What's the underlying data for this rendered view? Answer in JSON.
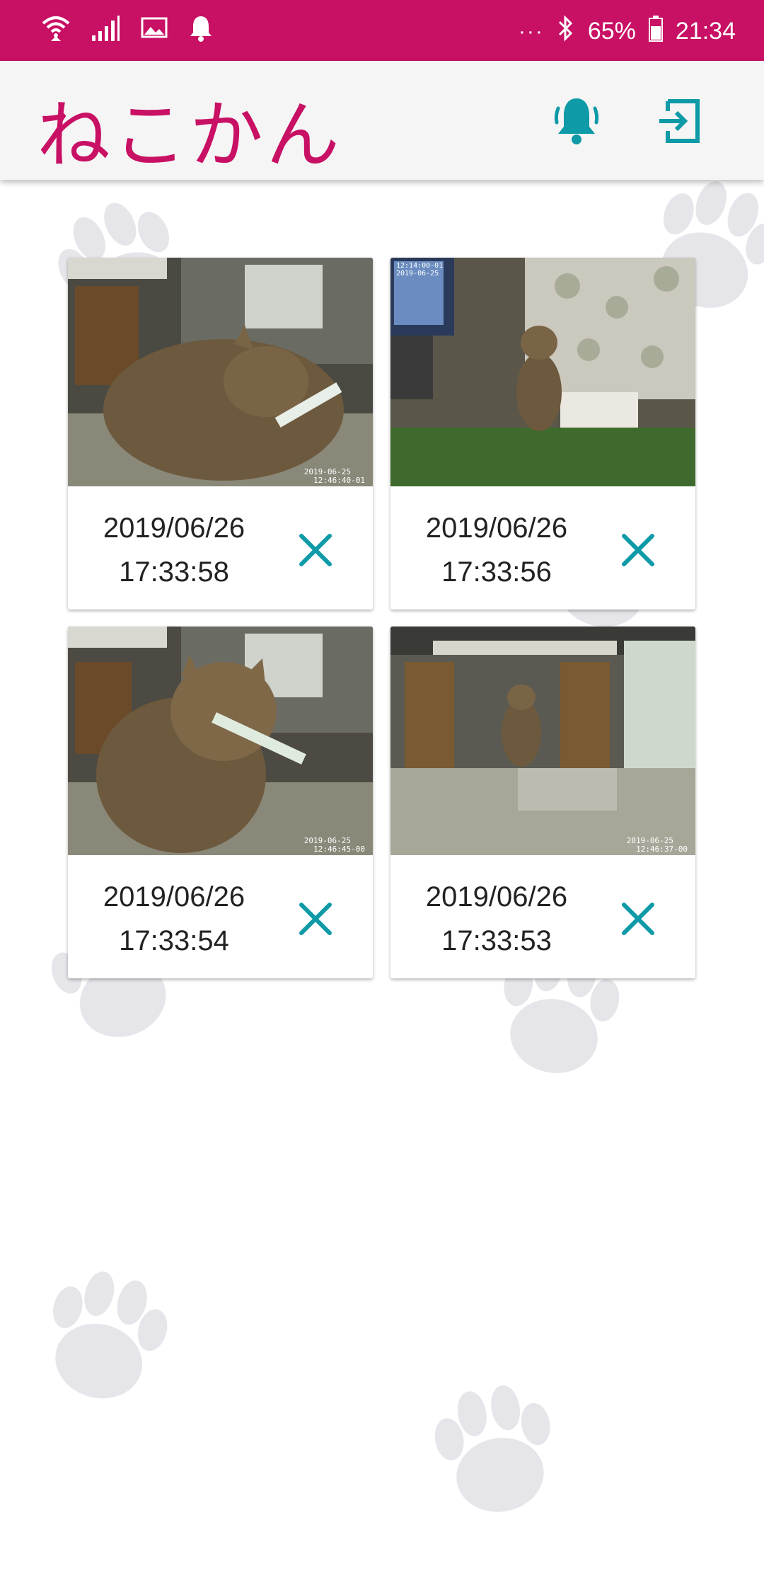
{
  "status_bar": {
    "battery": "65%",
    "time": "21:34",
    "overflow": "···",
    "icons": [
      "wifi-icon",
      "signal-icon",
      "gallery-icon",
      "notification-bell-icon",
      "bluetooth-icon",
      "battery-icon"
    ]
  },
  "app_bar": {
    "title": "ねこかん",
    "actions": [
      "notification-bell-icon",
      "logout-icon"
    ]
  },
  "photos": [
    {
      "date": "2019/06/26",
      "time": "17:33:58"
    },
    {
      "date": "2019/06/26",
      "time": "17:33:56"
    },
    {
      "date": "2019/06/26",
      "time": "17:33:54"
    },
    {
      "date": "2019/06/26",
      "time": "17:33:53"
    }
  ],
  "colors": {
    "brand": "#c81064",
    "accent": "#0e9aa7",
    "paw": "#e6e6ea"
  }
}
